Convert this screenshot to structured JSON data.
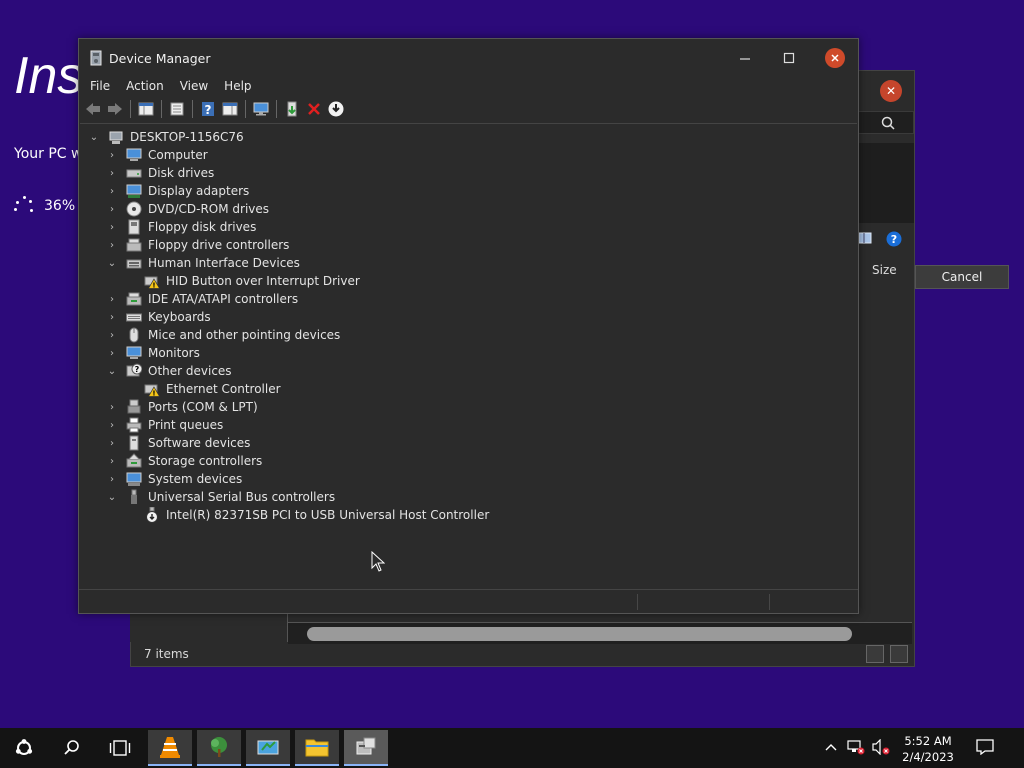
{
  "installer": {
    "title": "Ins",
    "subtitle": "Your PC w",
    "progress": "36%"
  },
  "background_window": {
    "size_header": "Size",
    "cancel_label": "Cancel",
    "status": "7 items",
    "close_glyph": "✕"
  },
  "device_manager": {
    "title": "Device Manager",
    "menu": [
      "File",
      "Action",
      "View",
      "Help"
    ],
    "toolbar_icons": [
      "back-icon",
      "forward-icon",
      "show-hide-console-tree-icon",
      "properties-icon",
      "help-icon",
      "action-pane-icon",
      "monitor-icon",
      "update-driver-icon",
      "uninstall-icon",
      "scan-hardware-icon"
    ],
    "tree": {
      "root": "DESKTOP-1156C76",
      "items": [
        {
          "label": "Computer",
          "expanded": false
        },
        {
          "label": "Disk drives",
          "expanded": false
        },
        {
          "label": "Display adapters",
          "expanded": false
        },
        {
          "label": "DVD/CD-ROM drives",
          "expanded": false
        },
        {
          "label": "Floppy disk drives",
          "expanded": false
        },
        {
          "label": "Floppy drive controllers",
          "expanded": false
        },
        {
          "label": "Human Interface Devices",
          "expanded": true
        },
        {
          "label": "HID Button over Interrupt Driver",
          "child": true,
          "warning": true
        },
        {
          "label": "IDE ATA/ATAPI controllers",
          "expanded": false
        },
        {
          "label": "Keyboards",
          "expanded": false
        },
        {
          "label": "Mice and other pointing devices",
          "expanded": false
        },
        {
          "label": "Monitors",
          "expanded": false
        },
        {
          "label": "Other devices",
          "expanded": true
        },
        {
          "label": "Ethernet Controller",
          "child": true,
          "warning": true
        },
        {
          "label": "Ports (COM & LPT)",
          "expanded": false
        },
        {
          "label": "Print queues",
          "expanded": false
        },
        {
          "label": "Software devices",
          "expanded": false
        },
        {
          "label": "Storage controllers",
          "expanded": false
        },
        {
          "label": "System devices",
          "expanded": false
        },
        {
          "label": "Universal Serial Bus controllers",
          "expanded": true
        },
        {
          "label": "Intel(R) 82371SB PCI to USB Universal Host Controller",
          "child": true,
          "warning": false
        }
      ]
    }
  },
  "taskbar": {
    "time": "5:52 AM",
    "date": "2/4/2023"
  },
  "colors": {
    "desktop": "#2c0a7a",
    "window": "#2b2b2b",
    "close": "#cf4a2a"
  }
}
